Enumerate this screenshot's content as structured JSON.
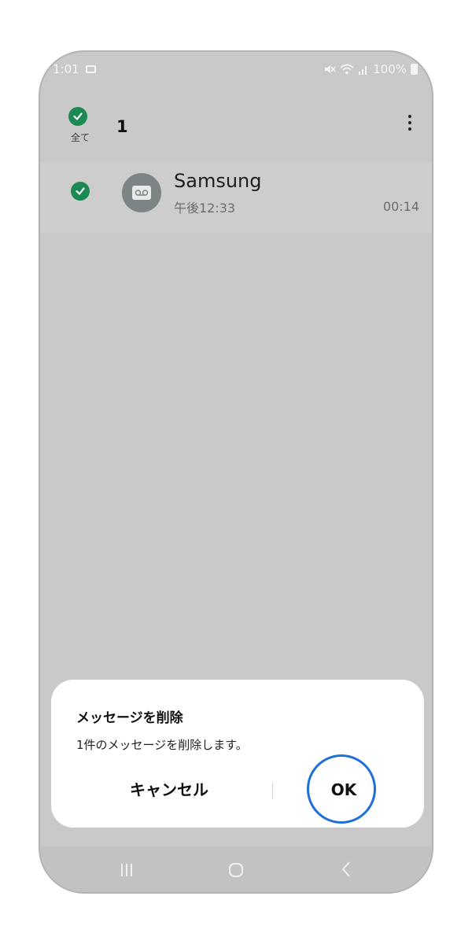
{
  "status_bar": {
    "time": "1:01",
    "battery": "100%"
  },
  "header": {
    "select_all_label": "全て",
    "selected_count": "1"
  },
  "voicemail": {
    "name": "Samsung",
    "time": "午後12:33",
    "duration": "00:14"
  },
  "dialog": {
    "title": "メッセージを削除",
    "body": "1件のメッセージを削除します。",
    "cancel_label": "キャンセル",
    "ok_label": "OK"
  },
  "colors": {
    "check_green": "#1b8a52",
    "highlight_blue": "#1f6fd6"
  },
  "icons": [
    "message-notification-icon",
    "mute-icon",
    "wifi-icon",
    "signal-icon",
    "battery-icon",
    "checkmark-icon",
    "voicemail-icon",
    "more-options-icon",
    "recent-apps-icon",
    "home-icon",
    "back-icon"
  ]
}
